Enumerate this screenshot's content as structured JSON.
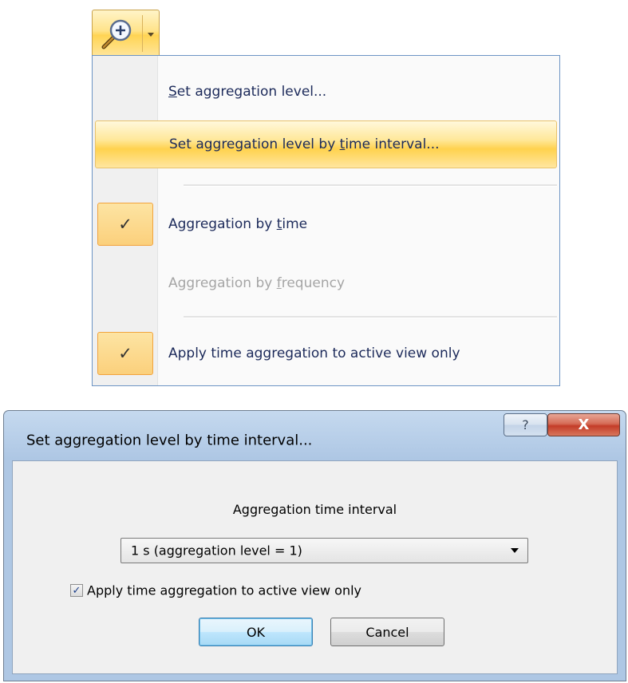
{
  "menu": {
    "items": [
      {
        "pre": "",
        "acc": "S",
        "post": "et aggregation level...",
        "state": "normal",
        "checked": false
      },
      {
        "pre": "Set aggregation level by ",
        "acc": "t",
        "post": "ime interval...",
        "state": "hover",
        "checked": false
      },
      {
        "pre": "Aggregation by ",
        "acc": "t",
        "post": "ime",
        "state": "normal",
        "checked": true
      },
      {
        "pre": "Aggregation by ",
        "acc": "f",
        "post": "requency",
        "state": "disabled",
        "checked": false
      },
      {
        "pre": "Apply time aggregation to active view only",
        "acc": "",
        "post": "",
        "state": "normal",
        "checked": true
      }
    ],
    "check_glyph": "✓"
  },
  "zoom_button": {
    "icon": "zoom-in-magnifier-icon",
    "arrow_icon": "dropdown-arrow-icon"
  },
  "dialog": {
    "title": "Set aggregation level by time interval...",
    "help_glyph": "?",
    "close_glyph": "X",
    "group_label": "Aggregation time interval",
    "interval_value": "1 s (aggregation level = 1)",
    "checkbox_label": "Apply time aggregation to active view only",
    "checkbox_checked": true,
    "ok_label": "OK",
    "cancel_label": "Cancel"
  },
  "colors": {
    "menu_border": "#6c94c4",
    "hover_gold": "#ffd24e",
    "check_border": "#f2a33c",
    "dialog_frame": "#aec7e4",
    "close_red": "#c43c28"
  }
}
